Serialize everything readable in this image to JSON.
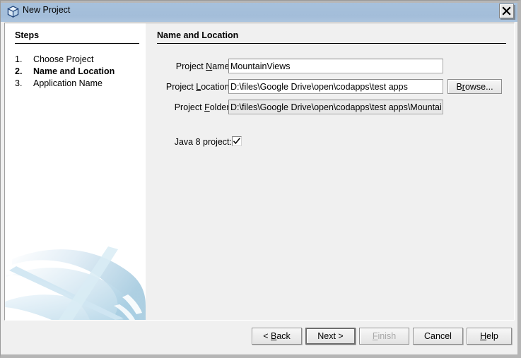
{
  "window": {
    "title": "New Project",
    "icon": "project-cube-icon",
    "close_label": "✕",
    "accent_titlebar": "#a3bdd9",
    "pane_background": "#f0f0f0",
    "steps_background": "#ffffff"
  },
  "steps": {
    "heading": "Steps",
    "items": [
      {
        "number": "1.",
        "label": "Choose Project",
        "current": false
      },
      {
        "number": "2.",
        "label": "Name and Location",
        "current": true
      },
      {
        "number": "3.",
        "label": "Application Name",
        "current": false
      }
    ]
  },
  "form": {
    "heading": "Name and Location",
    "fields": [
      {
        "label_pre": "Project ",
        "label_mnemonic": "N",
        "label_post": "ame:",
        "value": "MountainViews",
        "placeholder": "",
        "readonly": false
      },
      {
        "label_pre": "Project ",
        "label_mnemonic": "L",
        "label_post": "ocation:",
        "value": "D:\\files\\Google Drive\\open\\codapps\\test apps",
        "placeholder": "",
        "readonly": false
      },
      {
        "label_pre": "Project ",
        "label_mnemonic": "F",
        "label_post": "older:",
        "value": "D:\\files\\Google Drive\\open\\codapps\\test apps\\MountainViews",
        "placeholder": "",
        "readonly": true
      }
    ],
    "browse": {
      "pre": "B",
      "mnemonic": "r",
      "post": "owse..."
    },
    "checkbox": {
      "label": "Java 8 project:",
      "checked": true
    }
  },
  "footer": {
    "buttons": [
      {
        "id": "back",
        "pre": "< ",
        "mnemonic": "B",
        "post": "ack",
        "default": false,
        "disabled": false
      },
      {
        "id": "next",
        "pre": "Next >",
        "mnemonic": "",
        "post": "",
        "default": true,
        "disabled": false
      },
      {
        "id": "finish",
        "pre": "",
        "mnemonic": "F",
        "post": "inish",
        "default": false,
        "disabled": true
      },
      {
        "id": "cancel",
        "pre": "Cancel",
        "mnemonic": "",
        "post": "",
        "default": false,
        "disabled": false
      },
      {
        "id": "help",
        "pre": "",
        "mnemonic": "H",
        "post": "elp",
        "default": false,
        "disabled": false
      }
    ]
  }
}
